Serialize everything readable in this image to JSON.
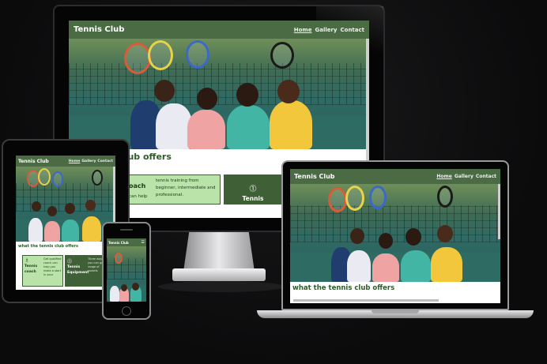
{
  "site": {
    "brand": "Tennis Club",
    "nav": [
      "Home",
      "Gallery",
      "Contact"
    ],
    "active_nav": "Home"
  },
  "desktop": {
    "offers_title": "is club offers",
    "coach_label": "oach",
    "coach_sub": "can help",
    "coach_text": "tennis training from beginner, intermediate and professional.",
    "equipment_label": "Tennis Equipment"
  },
  "laptop": {
    "offers_title": "what the tennis club offers"
  },
  "tablet": {
    "offers_title": "what the tennis club offers",
    "coach_label": "Tennis coach",
    "coach_text": "Get qualified coach can help you make a start in your",
    "equipment_label": "Tennis Equipment",
    "equipment_text": "Three ways you can get a range of rackets"
  },
  "phone": {
    "brand": "Tennis Club"
  },
  "colors": {
    "nav_green": "#4a6b44",
    "card_green": "#b9e3a8",
    "dark_card": "#3f5f37",
    "title_green": "#2f5a2b"
  }
}
